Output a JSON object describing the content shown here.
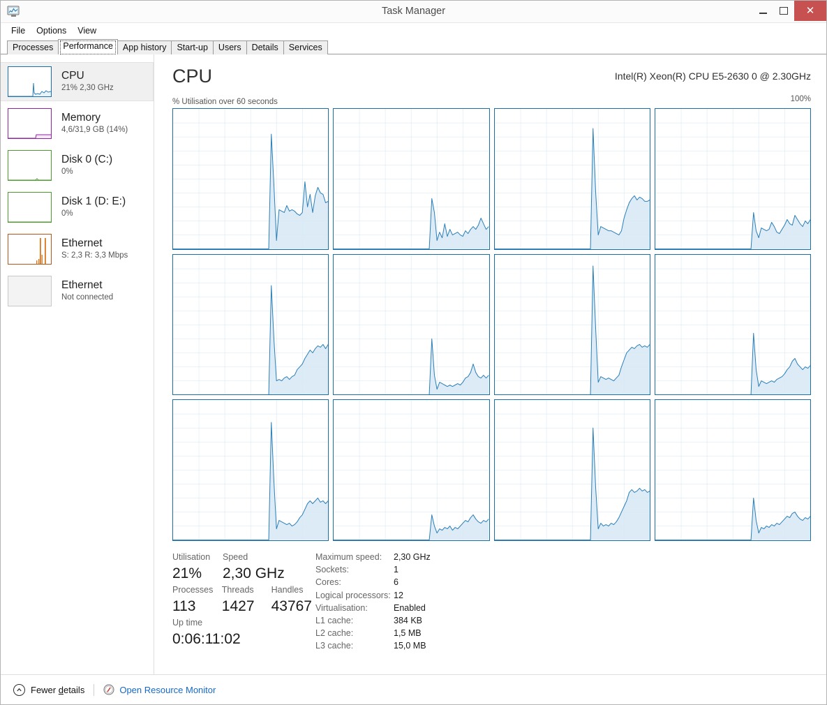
{
  "window": {
    "title": "Task Manager",
    "app_icon": "task-manager-icon",
    "controls": {
      "minimize": "minimize-icon",
      "maximize": "maximize-icon",
      "close": "close-icon",
      "close_color": "#c75050"
    }
  },
  "menu": {
    "items": [
      {
        "label": "File"
      },
      {
        "label": "Options"
      },
      {
        "label": "View"
      }
    ]
  },
  "tabs": {
    "active_index": 1,
    "items": [
      {
        "label": "Processes"
      },
      {
        "label": "Performance"
      },
      {
        "label": "App history"
      },
      {
        "label": "Start-up"
      },
      {
        "label": "Users"
      },
      {
        "label": "Details"
      },
      {
        "label": "Services"
      }
    ]
  },
  "sidebar": {
    "items": [
      {
        "name": "CPU",
        "title": "CPU",
        "subtitle": "21% 2,30 GHz",
        "selected": true,
        "accent": "#1a6fa8"
      },
      {
        "name": "Memory",
        "title": "Memory",
        "subtitle": "4,6/31,9 GB (14%)",
        "selected": false,
        "accent": "#8f24a0"
      },
      {
        "name": "Disk 0",
        "title": "Disk 0 (C:)",
        "subtitle": "0%",
        "selected": false,
        "accent": "#4a9c2d"
      },
      {
        "name": "Disk 1",
        "title": "Disk 1 (D: E:)",
        "subtitle": "0%",
        "selected": false,
        "accent": "#4a9c2d"
      },
      {
        "name": "Ethernet active",
        "title": "Ethernet",
        "subtitle_prefix_s": "S:",
        "subtitle_send": "2,3",
        "subtitle_prefix_r": "R:",
        "subtitle_recv": "3,3 Mbps",
        "subtitle": "S: 2,3 R: 3,3 Mbps",
        "selected": false,
        "accent": "#b4561a"
      },
      {
        "name": "Ethernet disconnected",
        "title": "Ethernet",
        "subtitle": "Not connected",
        "selected": false,
        "accent": "#c8c8c8"
      }
    ]
  },
  "main": {
    "heading": "CPU",
    "model": "Intel(R) Xeon(R) CPU E5-2630 0 @ 2.30GHz",
    "axis_label": "% Utilisation over 60 seconds",
    "axis_max": "100%"
  },
  "chart_data": {
    "type": "line",
    "title": "% Utilisation over 60 seconds",
    "xlabel": "60 seconds",
    "ylabel": "% Utilisation",
    "ylim": [
      0,
      100
    ],
    "xlim": [
      0,
      60
    ],
    "grid": true,
    "legend": "none",
    "line_color": "#2a7fb8",
    "fill_color": "#d6e8f4",
    "border_color": "#1a6fa8",
    "grid_color": "#cfe2ef",
    "columns": 4,
    "rows": 3,
    "note": "12 logical processors, one mini graph each; x axis 0-60 s, y axis 0-100%",
    "series": [
      {
        "name": "CPU 0",
        "values": [
          0,
          0,
          0,
          0,
          0,
          0,
          0,
          0,
          0,
          0,
          0,
          0,
          0,
          0,
          0,
          0,
          0,
          0,
          0,
          0,
          0,
          0,
          0,
          0,
          0,
          0,
          0,
          0,
          0,
          0,
          0,
          0,
          0,
          0,
          0,
          0,
          0,
          0,
          82,
          46,
          6,
          28,
          27,
          26,
          31,
          27,
          28,
          27,
          25,
          24,
          26,
          48,
          30,
          39,
          26,
          38,
          44,
          40,
          39,
          33,
          34
        ]
      },
      {
        "name": "CPU 1",
        "values": [
          0,
          0,
          0,
          0,
          0,
          0,
          0,
          0,
          0,
          0,
          0,
          0,
          0,
          0,
          0,
          0,
          0,
          0,
          0,
          0,
          0,
          0,
          0,
          0,
          0,
          0,
          0,
          0,
          0,
          0,
          0,
          0,
          0,
          0,
          0,
          0,
          0,
          0,
          36,
          26,
          6,
          12,
          8,
          18,
          9,
          14,
          10,
          11,
          12,
          10,
          9,
          13,
          11,
          14,
          16,
          14,
          17,
          22,
          18,
          14,
          16
        ]
      },
      {
        "name": "CPU 2",
        "values": [
          0,
          0,
          0,
          0,
          0,
          0,
          0,
          0,
          0,
          0,
          0,
          0,
          0,
          0,
          0,
          0,
          0,
          0,
          0,
          0,
          0,
          0,
          0,
          0,
          0,
          0,
          0,
          0,
          0,
          0,
          0,
          0,
          0,
          0,
          0,
          0,
          0,
          0,
          86,
          41,
          10,
          16,
          15,
          14,
          13,
          13,
          12,
          11,
          10,
          13,
          22,
          28,
          33,
          36,
          38,
          35,
          37,
          36,
          34,
          34,
          35
        ]
      },
      {
        "name": "CPU 3",
        "values": [
          0,
          0,
          0,
          0,
          0,
          0,
          0,
          0,
          0,
          0,
          0,
          0,
          0,
          0,
          0,
          0,
          0,
          0,
          0,
          0,
          0,
          0,
          0,
          0,
          0,
          0,
          0,
          0,
          0,
          0,
          0,
          0,
          0,
          0,
          0,
          0,
          0,
          0,
          26,
          13,
          8,
          15,
          14,
          13,
          14,
          19,
          16,
          12,
          11,
          14,
          17,
          21,
          18,
          17,
          24,
          21,
          18,
          16,
          20,
          18,
          21
        ]
      },
      {
        "name": "CPU 4",
        "values": [
          0,
          0,
          0,
          0,
          0,
          0,
          0,
          0,
          0,
          0,
          0,
          0,
          0,
          0,
          0,
          0,
          0,
          0,
          0,
          0,
          0,
          0,
          0,
          0,
          0,
          0,
          0,
          0,
          0,
          0,
          0,
          0,
          0,
          0,
          0,
          0,
          0,
          0,
          78,
          40,
          10,
          11,
          10,
          12,
          13,
          11,
          13,
          14,
          18,
          20,
          22,
          26,
          29,
          32,
          30,
          33,
          35,
          34,
          36,
          33,
          36
        ]
      },
      {
        "name": "CPU 5",
        "values": [
          0,
          0,
          0,
          0,
          0,
          0,
          0,
          0,
          0,
          0,
          0,
          0,
          0,
          0,
          0,
          0,
          0,
          0,
          0,
          0,
          0,
          0,
          0,
          0,
          0,
          0,
          0,
          0,
          0,
          0,
          0,
          0,
          0,
          0,
          0,
          0,
          0,
          0,
          40,
          14,
          4,
          9,
          8,
          7,
          6,
          7,
          6,
          7,
          8,
          7,
          9,
          12,
          13,
          16,
          22,
          16,
          13,
          12,
          14,
          12,
          14
        ]
      },
      {
        "name": "CPU 6",
        "values": [
          0,
          0,
          0,
          0,
          0,
          0,
          0,
          0,
          0,
          0,
          0,
          0,
          0,
          0,
          0,
          0,
          0,
          0,
          0,
          0,
          0,
          0,
          0,
          0,
          0,
          0,
          0,
          0,
          0,
          0,
          0,
          0,
          0,
          0,
          0,
          0,
          0,
          0,
          92,
          48,
          9,
          13,
          12,
          11,
          12,
          11,
          10,
          12,
          14,
          20,
          25,
          30,
          32,
          34,
          33,
          35,
          36,
          34,
          35,
          34,
          36
        ]
      },
      {
        "name": "CPU 7",
        "values": [
          0,
          0,
          0,
          0,
          0,
          0,
          0,
          0,
          0,
          0,
          0,
          0,
          0,
          0,
          0,
          0,
          0,
          0,
          0,
          0,
          0,
          0,
          0,
          0,
          0,
          0,
          0,
          0,
          0,
          0,
          0,
          0,
          0,
          0,
          0,
          0,
          0,
          0,
          44,
          18,
          6,
          10,
          9,
          8,
          9,
          10,
          9,
          11,
          12,
          13,
          15,
          18,
          20,
          24,
          26,
          22,
          20,
          18,
          20,
          19,
          21
        ]
      },
      {
        "name": "CPU 8",
        "values": [
          0,
          0,
          0,
          0,
          0,
          0,
          0,
          0,
          0,
          0,
          0,
          0,
          0,
          0,
          0,
          0,
          0,
          0,
          0,
          0,
          0,
          0,
          0,
          0,
          0,
          0,
          0,
          0,
          0,
          0,
          0,
          0,
          0,
          0,
          0,
          0,
          0,
          0,
          84,
          42,
          8,
          14,
          13,
          12,
          11,
          12,
          10,
          11,
          13,
          16,
          18,
          22,
          26,
          28,
          26,
          28,
          30,
          27,
          28,
          26,
          28
        ]
      },
      {
        "name": "CPU 9",
        "values": [
          0,
          0,
          0,
          0,
          0,
          0,
          0,
          0,
          0,
          0,
          0,
          0,
          0,
          0,
          0,
          0,
          0,
          0,
          0,
          0,
          0,
          0,
          0,
          0,
          0,
          0,
          0,
          0,
          0,
          0,
          0,
          0,
          0,
          0,
          0,
          0,
          0,
          0,
          18,
          10,
          5,
          8,
          7,
          9,
          8,
          10,
          7,
          9,
          8,
          10,
          12,
          14,
          13,
          16,
          18,
          15,
          13,
          12,
          14,
          13,
          15
        ]
      },
      {
        "name": "CPU 10",
        "values": [
          0,
          0,
          0,
          0,
          0,
          0,
          0,
          0,
          0,
          0,
          0,
          0,
          0,
          0,
          0,
          0,
          0,
          0,
          0,
          0,
          0,
          0,
          0,
          0,
          0,
          0,
          0,
          0,
          0,
          0,
          0,
          0,
          0,
          0,
          0,
          0,
          0,
          0,
          80,
          38,
          8,
          12,
          10,
          11,
          10,
          12,
          11,
          13,
          16,
          20,
          24,
          28,
          34,
          36,
          34,
          35,
          37,
          35,
          36,
          34,
          35
        ]
      },
      {
        "name": "CPU 11",
        "values": [
          0,
          0,
          0,
          0,
          0,
          0,
          0,
          0,
          0,
          0,
          0,
          0,
          0,
          0,
          0,
          0,
          0,
          0,
          0,
          0,
          0,
          0,
          0,
          0,
          0,
          0,
          0,
          0,
          0,
          0,
          0,
          0,
          0,
          0,
          0,
          0,
          0,
          0,
          30,
          14,
          5,
          9,
          8,
          10,
          9,
          11,
          10,
          12,
          11,
          13,
          15,
          17,
          16,
          19,
          20,
          17,
          15,
          14,
          16,
          15,
          17
        ]
      }
    ]
  },
  "stats": {
    "utilisation_label": "Utilisation",
    "utilisation_value": "21%",
    "speed_label": "Speed",
    "speed_value": "2,30 GHz",
    "processes_label": "Processes",
    "processes_value": "113",
    "threads_label": "Threads",
    "threads_value": "1427",
    "handles_label": "Handles",
    "handles_value": "43767",
    "uptime_label": "Up time",
    "uptime_value": "0:06:11:02",
    "details": [
      {
        "key": "Maximum speed:",
        "value": "2,30 GHz"
      },
      {
        "key": "Sockets:",
        "value": "1"
      },
      {
        "key": "Cores:",
        "value": "6"
      },
      {
        "key": "Logical processors:",
        "value": "12"
      },
      {
        "key": "Virtualisation:",
        "value": "Enabled"
      },
      {
        "key": "L1 cache:",
        "value": "384 KB"
      },
      {
        "key": "L2 cache:",
        "value": "1,5 MB"
      },
      {
        "key": "L3 cache:",
        "value": "15,0 MB"
      }
    ]
  },
  "footer": {
    "fewer_details_pre": "Fewer ",
    "fewer_details_accel": "d",
    "fewer_details_post": "etails",
    "fewer_details": "Fewer details",
    "resource_monitor": "Open Resource Monitor",
    "link_color": "#1569c7"
  }
}
